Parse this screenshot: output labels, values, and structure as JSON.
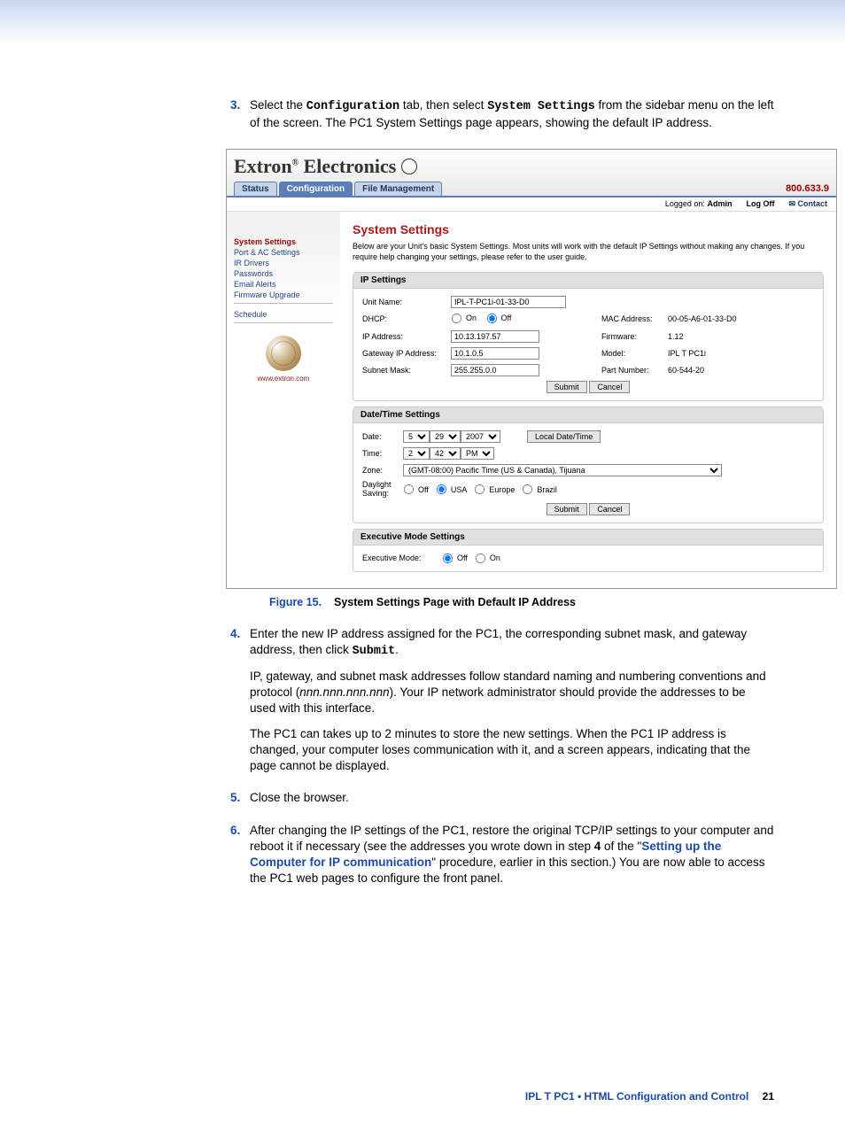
{
  "step3": {
    "num": "3.",
    "text_a": "Select the ",
    "conf": "Configuration",
    "text_b": " tab, then select ",
    "sys": "System Settings",
    "text_c": " from the sidebar menu on the left of the screen. The PC1 System Settings page appears, showing the default IP address."
  },
  "screenshot": {
    "brand_a": "Extron",
    "brand_b": " Electronics",
    "tabs": {
      "status": "Status",
      "config": "Configuration",
      "filemgmt": "File Management"
    },
    "phone": "800.633.9",
    "logged": "Logged on:",
    "logged_user": "Admin",
    "logoff": "Log Off",
    "contact": "Contact",
    "sidebar": {
      "sys": "System Settings",
      "port": "Port & AC Settings",
      "ir": "IR Drivers",
      "pass": "Passwords",
      "email": "Email Alerts",
      "fw": "Firmware Upgrade",
      "sched": "Schedule",
      "url": "www.extron.com"
    },
    "title": "System Settings",
    "desc": "Below are your Unit's basic System Settings. Most units will work with the default IP Settings without making any changes. If you require help changing your settings, please refer to the user guide.",
    "ip_panel": {
      "head": "IP Settings",
      "unit_lbl": "Unit Name:",
      "unit_val": "IPL-T-PC1i-01-33-D0",
      "dhcp_lbl": "DHCP:",
      "dhcp_on": "On",
      "dhcp_off": "Off",
      "ipaddr_lbl": "IP Address:",
      "ipaddr_val": "10.13.197.57",
      "gw_lbl": "Gateway IP Address:",
      "gw_val": "10.1.0.5",
      "sm_lbl": "Subnet Mask:",
      "sm_val": "255.255.0.0",
      "mac_lbl": "MAC Address:",
      "mac_val": "00-05-A6-01-33-D0",
      "fw_lbl": "Firmware:",
      "fw_val": "1.12",
      "model_lbl": "Model:",
      "model_val": "IPL T PC1i",
      "pn_lbl": "Part Number:",
      "pn_val": "60-544-20",
      "submit": "Submit",
      "cancel": "Cancel"
    },
    "dt_panel": {
      "head": "Date/Time Settings",
      "date_lbl": "Date:",
      "date_m": "5",
      "date_d": "29",
      "date_y": "2007",
      "local_btn": "Local Date/Time",
      "time_lbl": "Time:",
      "time_h": "2",
      "time_m": "42",
      "time_ap": "PM",
      "zone_lbl": "Zone:",
      "zone_val": "(GMT-08:00) Pacific Time (US & Canada), Tijuana",
      "ds_lbl": "Daylight Saving:",
      "ds_off": "Off",
      "ds_usa": "USA",
      "ds_eu": "Europe",
      "ds_br": "Brazil",
      "submit": "Submit",
      "cancel": "Cancel"
    },
    "exec_panel": {
      "head": "Executive Mode Settings",
      "lbl": "Executive Mode:",
      "off": "Off",
      "on": "On"
    }
  },
  "figure": {
    "num": "Figure 15.",
    "title": "System Settings Page with Default IP Address"
  },
  "step4": {
    "num": "4.",
    "p1_a": "Enter the new IP address assigned for the PC1, the corresponding subnet mask, and gateway address, then click ",
    "p1_b": "Submit",
    "p1_c": ".",
    "p2_a": "IP, gateway, and subnet mask addresses follow standard naming and numbering conventions and protocol (",
    "p2_b": "nnn.nnn.nnn.nnn",
    "p2_c": "). Your IP network administrator should provide the addresses to be used with this interface.",
    "p3": "The PC1 can takes up to 2 minutes to store the new settings. When the PC1 IP address is changed, your computer loses communication with it, and a screen appears, indicating that the page cannot be displayed."
  },
  "step5": {
    "num": "5.",
    "text": "Close the browser."
  },
  "step6": {
    "num": "6.",
    "a": "After changing the IP settings of the PC1, restore the original TCP/IP settings to your computer and reboot it if necessary (see the addresses you wrote down in step ",
    "b": "4",
    "c": " of the \"",
    "link": "Setting up the Computer for IP communication",
    "d": "\" procedure, earlier in this section.) You are now able to access the PC1 web pages to configure the front panel."
  },
  "footer": {
    "doc": "IPL T PC1 • HTML Configuration and Control",
    "page": "21"
  }
}
